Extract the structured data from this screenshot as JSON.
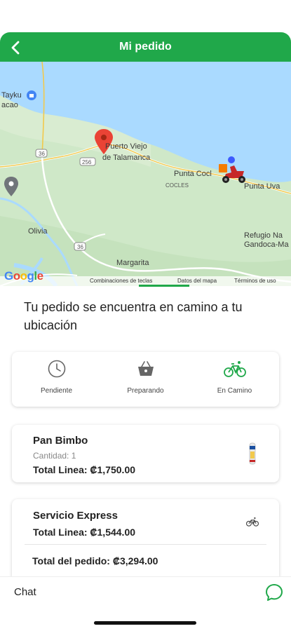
{
  "header": {
    "title": "Mi pedido",
    "back_icon": "chevron-left-icon"
  },
  "map": {
    "labels": {
      "tayku": "Tayku",
      "cacao": "acao",
      "puerto_viejo_1": "Puerto Viejo",
      "puerto_viejo_2": "de Talamanca",
      "punta_cocles": "Punta Cocl",
      "cocles": "COCLES",
      "punta_uva": "Punta Uva",
      "refugio_1": "Refugio Na",
      "refugio_2": "Gandoca-Ma",
      "olivia": "Olivia",
      "margarita": "Margarita",
      "road_36": "36",
      "road_256": "256",
      "road_36b": "36"
    },
    "footer": {
      "logo": "Google",
      "shortcuts": "Combinaciones de teclas",
      "map_data": "Datos del mapa",
      "terms": "Términos de uso"
    },
    "pin_color": "#ea4335",
    "courier_icon": "delivery-scooter-icon"
  },
  "status_message": "Tu pedido se encuentra en camino a tu ubicación",
  "steps": [
    {
      "label": "Pendiente",
      "icon": "clock-icon",
      "active": false
    },
    {
      "label": "Preparando",
      "icon": "basket-icon",
      "active": false
    },
    {
      "label": "En Camino",
      "icon": "bicycle-icon",
      "active": true
    }
  ],
  "order_items": [
    {
      "name": "Pan Bimbo",
      "quantity": "Cantidad: 1",
      "total": "Total Linea: ₡1,750.00",
      "icon": "bread-bag-icon"
    },
    {
      "name": "Servicio Express",
      "total": "Total Linea: ₡1,544.00",
      "icon": "bicycle-icon"
    }
  ],
  "order_total": "Total del pedido: ₡3,294.00",
  "chat": {
    "label": "Chat",
    "icon": "chat-bubble-icon"
  },
  "colors": {
    "accent": "#20a84a",
    "sea": "#aadaff",
    "land": "#cfe8c8"
  }
}
